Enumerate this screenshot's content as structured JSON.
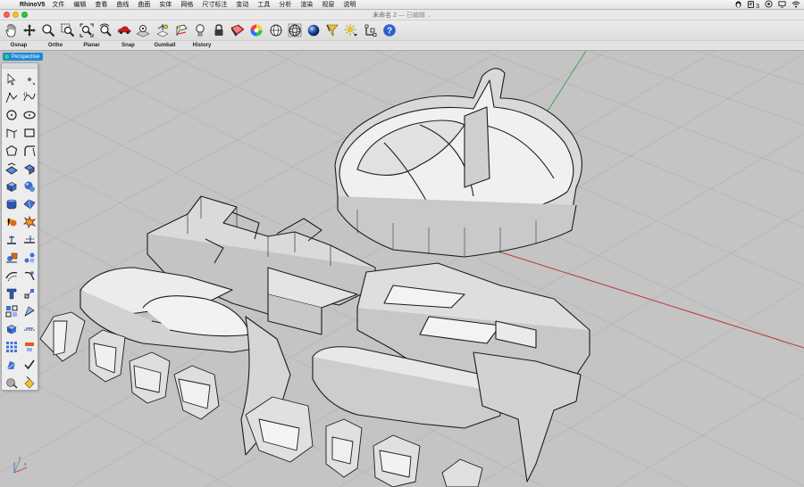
{
  "menubar": {
    "apple": "",
    "app_name": "RhinoV5",
    "items": [
      "文件",
      "编辑",
      "查看",
      "曲线",
      "曲面",
      "实体",
      "网格",
      "尺寸标注",
      "变动",
      "工具",
      "分析",
      "渲染",
      "视窗",
      "说明"
    ],
    "status_badge": "3"
  },
  "window": {
    "title": "未命名 2",
    "status": " — 已编辑"
  },
  "toolbar": {
    "icons": [
      "pan-hand-icon",
      "move-arrows-icon",
      "zoom-icon",
      "zoom-window-icon",
      "zoom-extents-icon",
      "rotate-view-icon",
      "car-icon",
      "zoom-selected-icon",
      "layers-icon",
      "set-cplane-icon",
      "light-bulb-icon",
      "lock-icon",
      "shade-icon",
      "color-wheel-icon",
      "wireframe-sphere-icon",
      "ghosted-sphere-icon",
      "render-sphere-icon",
      "select-filter-icon",
      "sun-icon",
      "gumball-icon",
      "help-icon"
    ]
  },
  "modes": {
    "osnap": "Osnap",
    "ortho": "Ortho",
    "planar": "Planar",
    "snap": "Snap",
    "gumball": "Gumball",
    "history": "History"
  },
  "viewport": {
    "label": "Perspective"
  },
  "palette": {
    "tools": [
      "select-arrow-icon",
      "point-icon",
      "polyline-icon",
      "curve-icon",
      "circle-icon",
      "ellipse-icon",
      "arc-icon",
      "rectangle-icon",
      "polygon-icon",
      "fillet-curve-icon",
      "surface-icon",
      "extrude-surface-icon",
      "box-icon",
      "sphere-icon",
      "cylinder-icon",
      "freeform-surface-icon",
      "boolean-icon",
      "explode-icon",
      "split-icon",
      "trim-icon",
      "group-icon",
      "ungroup-icon",
      "offset-icon",
      "fillet-icon",
      "text-icon",
      "dimension-icon",
      "transform-icon",
      "scale-icon",
      "block-icon",
      "mirror-icon",
      "array-icon",
      "align-icon",
      "analyze-icon",
      "check-icon",
      "render-icon",
      "paint-bucket-icon"
    ]
  },
  "colors": {
    "viewport_bg": "#c4c4c4",
    "grid_line": "#b3b3b3",
    "x_axis": "#b53a3a",
    "y_axis": "#3fa65a",
    "viewport_tab": "#1d8ad8"
  }
}
